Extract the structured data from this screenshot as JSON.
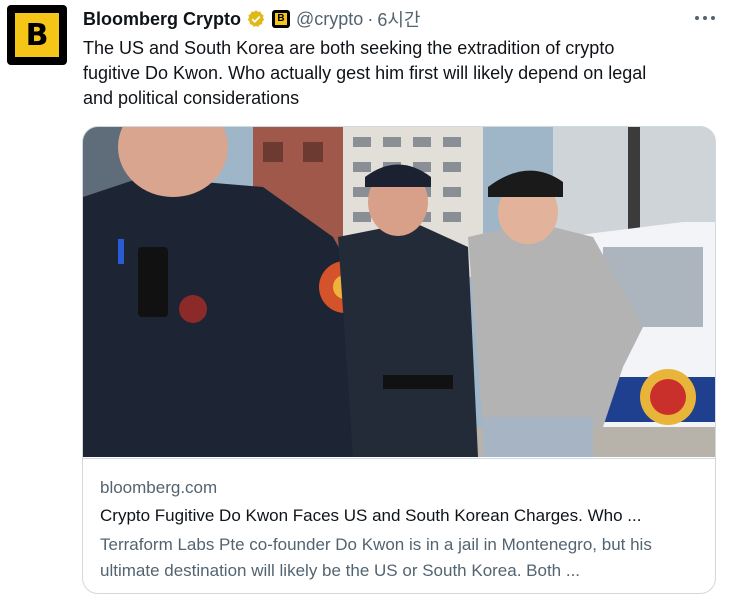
{
  "tweet": {
    "author_name": "Bloomberg Crypto",
    "affiliate_badge_letter": "B",
    "handle": "@crypto",
    "separator": "·",
    "time": "6시간",
    "avatar_letter": "B",
    "more_icon": "more-horizontal-icon",
    "text": "The US and South Korea are both seeking the extradition of crypto\nfugitive Do Kwon. Who actually gest him first will likely depend on legal\nand political considerations"
  },
  "card": {
    "domain": "bloomberg.com",
    "headline": "Crypto Fugitive Do Kwon Faces US and South Korean Charges. Who ...",
    "description": "Terraform Labs Pte co-founder Do Kwon is in a jail in Montenegro, but his ultimate destination will likely be the US or South Korea. Both ..."
  },
  "colors": {
    "brand_yellow": "#f5c518",
    "verified_gold": "#e2b719",
    "secondary_text": "#536471",
    "border": "#cfd9de"
  }
}
